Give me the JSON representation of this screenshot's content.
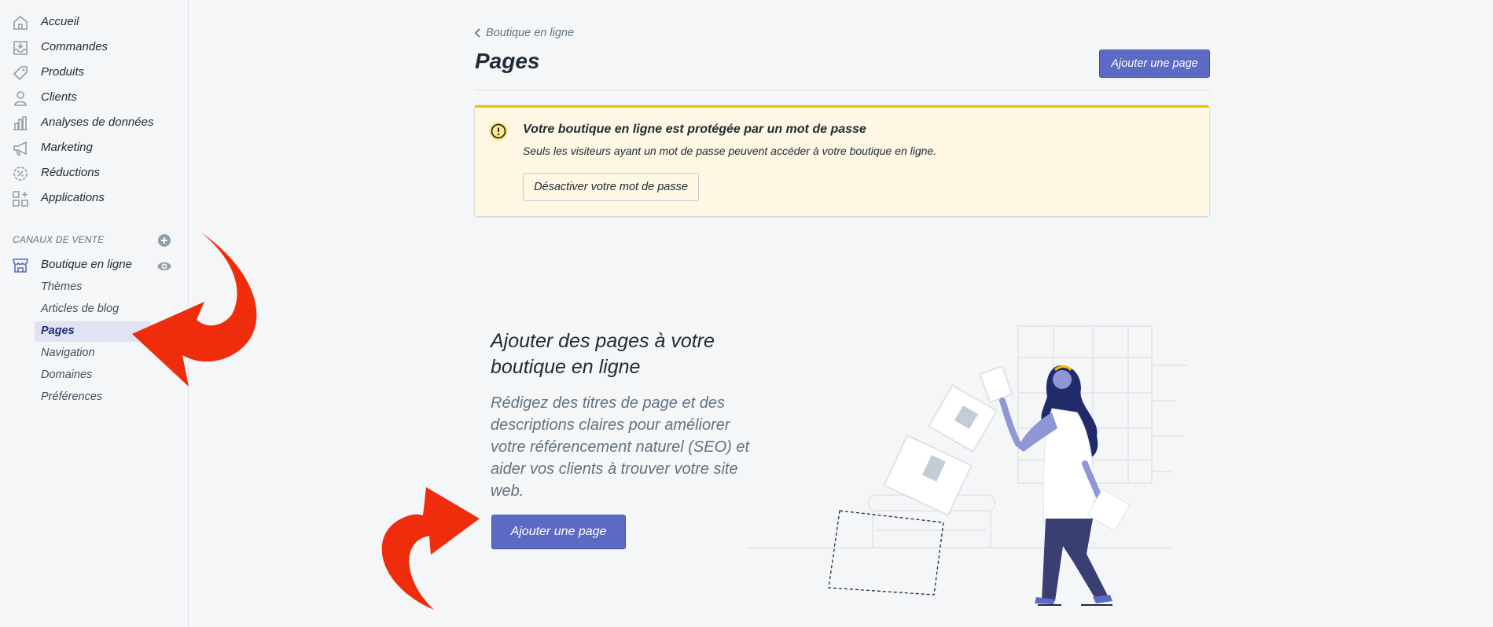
{
  "sidebar": {
    "items": [
      {
        "label": "Accueil",
        "icon": "home-icon"
      },
      {
        "label": "Commandes",
        "icon": "orders-icon"
      },
      {
        "label": "Produits",
        "icon": "tag-icon"
      },
      {
        "label": "Clients",
        "icon": "person-icon"
      },
      {
        "label": "Analyses de données",
        "icon": "analytics-icon"
      },
      {
        "label": "Marketing",
        "icon": "megaphone-icon"
      },
      {
        "label": "Réductions",
        "icon": "discount-icon"
      },
      {
        "label": "Applications",
        "icon": "apps-icon"
      }
    ],
    "sales_channels_title": "CANAUX DE VENTE",
    "channel": {
      "label": "Boutique en ligne",
      "icon": "store-icon"
    },
    "sub_items": [
      {
        "label": "Thèmes"
      },
      {
        "label": "Articles de blog"
      },
      {
        "label": "Pages"
      },
      {
        "label": "Navigation"
      },
      {
        "label": "Domaines"
      },
      {
        "label": "Préférences"
      }
    ]
  },
  "header": {
    "breadcrumb": "Boutique en ligne",
    "title": "Pages",
    "add_page_label": "Ajouter une page"
  },
  "banner": {
    "title": "Votre boutique en ligne est protégée par un mot de passe",
    "text": "Seuls les visiteurs ayant un mot de passe peuvent accéder à votre boutique en ligne.",
    "button_label": "Désactiver votre mot de passe"
  },
  "empty_state": {
    "heading": "Ajouter des pages à votre boutique en ligne",
    "description": "Rédigez des titres de page et des descriptions claires pour améliorer votre référencement naturel (SEO) et aider vos clients à trouver votre site web.",
    "button_label": "Ajouter une page"
  },
  "colors": {
    "accent": "#5c6ac4",
    "warning_border": "#eec200",
    "warning_bg": "#fdf7e3",
    "arrow": "#ef2c0c"
  }
}
